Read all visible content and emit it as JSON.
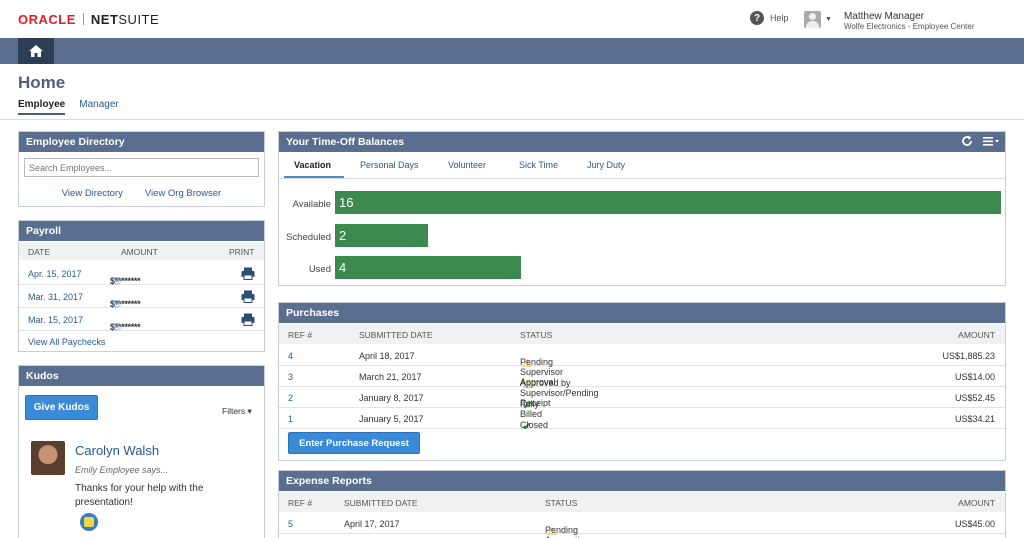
{
  "brand": {
    "oracle": "ORACLE",
    "netsuite_bold": "NET",
    "netsuite_rest": "SUITE"
  },
  "header": {
    "help_label": "Help",
    "user_name": "Matthew Manager",
    "user_sub": "Wolfe Electronics - Employee Center"
  },
  "page": {
    "title": "Home",
    "tabs": [
      {
        "label": "Employee",
        "active": true
      },
      {
        "label": "Manager",
        "active": false
      }
    ]
  },
  "directory": {
    "title": "Employee Directory",
    "search_placeholder": "Search Employees...",
    "link_view_directory": "View Directory",
    "link_view_org": "View Org Browser"
  },
  "payroll": {
    "title": "Payroll",
    "columns": {
      "date": "DATE",
      "amount": "AMOUNT",
      "print": "PRINT"
    },
    "rows": [
      {
        "date": "Apr. 15, 2017",
        "amount": "$********"
      },
      {
        "date": "Mar. 31, 2017",
        "amount": "$********"
      },
      {
        "date": "Mar. 15, 2017",
        "amount": "$********"
      }
    ],
    "view_all": "View All Paychecks"
  },
  "kudos": {
    "title": "Kudos",
    "button": "Give Kudos",
    "filters": "Filters",
    "name": "Carolyn Walsh",
    "says": "Emily Employee says...",
    "message": "Thanks for your help with the presentation!"
  },
  "timeoff": {
    "title": "Your Time-Off Balances",
    "tabs": [
      "Vacation",
      "Personal Days",
      "Volunteer",
      "Sick Time",
      "Jury Duty"
    ],
    "active_tab": "Vacation",
    "bars": [
      {
        "label": "Available",
        "value": 16
      },
      {
        "label": "Scheduled",
        "value": 2
      },
      {
        "label": "Used",
        "value": 4
      }
    ],
    "bar_color": "#3c8a4f"
  },
  "purchases": {
    "title": "Purchases",
    "columns": {
      "ref": "REF #",
      "date": "SUBMITTED DATE",
      "status": "STATUS",
      "amount": "AMOUNT"
    },
    "rows": [
      {
        "ref": "4",
        "date": "April 18, 2017",
        "status": "Pending Supervisor Approval",
        "icon": "warning-icon",
        "amount": "US$1,885.23"
      },
      {
        "ref": "3",
        "date": "March 21, 2017",
        "status": "Approved by Supervisor/Pending Receipt",
        "icon": "warning-icon",
        "amount": "US$14.00"
      },
      {
        "ref": "2",
        "date": "January 8, 2017",
        "status": "Fully Billed",
        "icon": "check-icon",
        "amount": "US$52.45"
      },
      {
        "ref": "1",
        "date": "January 5, 2017",
        "status": "Closed",
        "icon": "check-icon",
        "amount": "US$34.21"
      }
    ],
    "button": "Enter Purchase Request"
  },
  "expenses": {
    "title": "Expense Reports",
    "columns": {
      "ref": "REF #",
      "date": "SUBMITTED DATE",
      "status": "STATUS",
      "amount": "AMOUNT"
    },
    "rows": [
      {
        "ref": "5",
        "date": "April 17, 2017",
        "status": "Pending Accounting Approval",
        "icon": "warning-icon",
        "amount": "US$45.00"
      }
    ]
  },
  "colors": {
    "header_bar": "#5a6e90",
    "home_button": "#2f3e57",
    "link": "#2a5a92",
    "accent_button": "#3a8ad8"
  }
}
